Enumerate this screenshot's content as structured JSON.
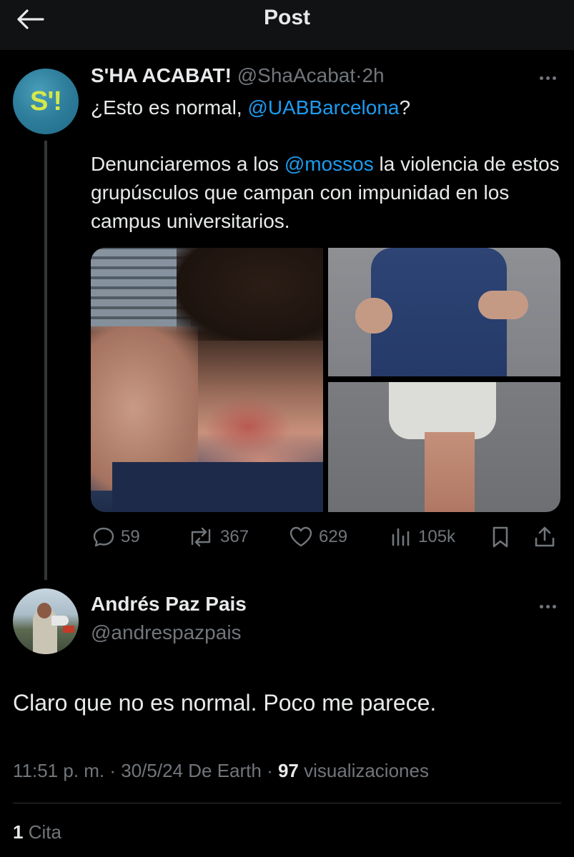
{
  "header": {
    "title": "Post"
  },
  "quoted_post": {
    "avatar_text": "S'!",
    "author_name": "S'HA ACABAT!",
    "author_handle": "@ShaAcabat",
    "separator": "·",
    "time": "2h",
    "line1_prefix": "¿Esto es normal, ",
    "line1_mention": "@UABBarcelona",
    "line1_suffix": "?",
    "para2_prefix": "Denunciaremos a los ",
    "para2_mention": "@mossos",
    "para2_suffix": " la violencia de estos grupúsculos que campan con impunidad en los campus universitarios.",
    "stats": {
      "replies": "59",
      "reposts": "367",
      "likes": "629",
      "views": "105k"
    }
  },
  "reply_post": {
    "author_name": "Andrés Paz Pais",
    "author_handle": "@andrespazpais",
    "text": "Claro que no es normal. Poco me parece.",
    "time": "11:51 p. m.",
    "separator1": " · ",
    "date_source": "30/5/24 De Earth",
    "separator2": " · ",
    "views_count": "97",
    "views_label": " visualizaciones",
    "quotes_count": "1",
    "quotes_label": " Cita"
  },
  "icons": {
    "back": "arrow-left-icon",
    "more": "more-horizontal-icon",
    "reply": "reply-bubble-icon",
    "repost": "repost-icon",
    "like": "heart-icon",
    "views": "views-bars-icon",
    "bookmark": "bookmark-icon",
    "share": "share-icon"
  },
  "colors": {
    "background": "#000000",
    "header_bg": "#111214",
    "text_primary": "#e7e9ea",
    "text_secondary": "#71767b",
    "link": "#1d9bf0",
    "avatar_logo": "#d6e84a"
  }
}
